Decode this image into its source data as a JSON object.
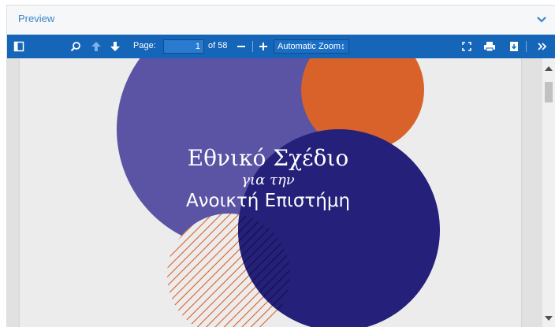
{
  "panel": {
    "title": "Preview"
  },
  "toolbar": {
    "page_label": "Page:",
    "page_value": "1",
    "page_total": "of 58",
    "zoom_value": "Automatic Zoom↕"
  },
  "document": {
    "title_line1": "Εθνικό Σχέδιο",
    "title_line2": "για την",
    "title_line3": "Ανοικτή Επιστήμη"
  },
  "colors": {
    "toolbar": "#1565b8",
    "circle_purple": "#5b54a4",
    "circle_orange": "#d9622b",
    "circle_navy": "#25207a",
    "accent_link": "#3a86c8"
  },
  "icons": [
    "sidebar-toggle-icon",
    "search-icon",
    "previous-page-icon",
    "next-page-icon",
    "minus-icon",
    "plus-icon",
    "fullscreen-icon",
    "print-icon",
    "download-icon",
    "tools-icon",
    "chevron-down-icon"
  ]
}
